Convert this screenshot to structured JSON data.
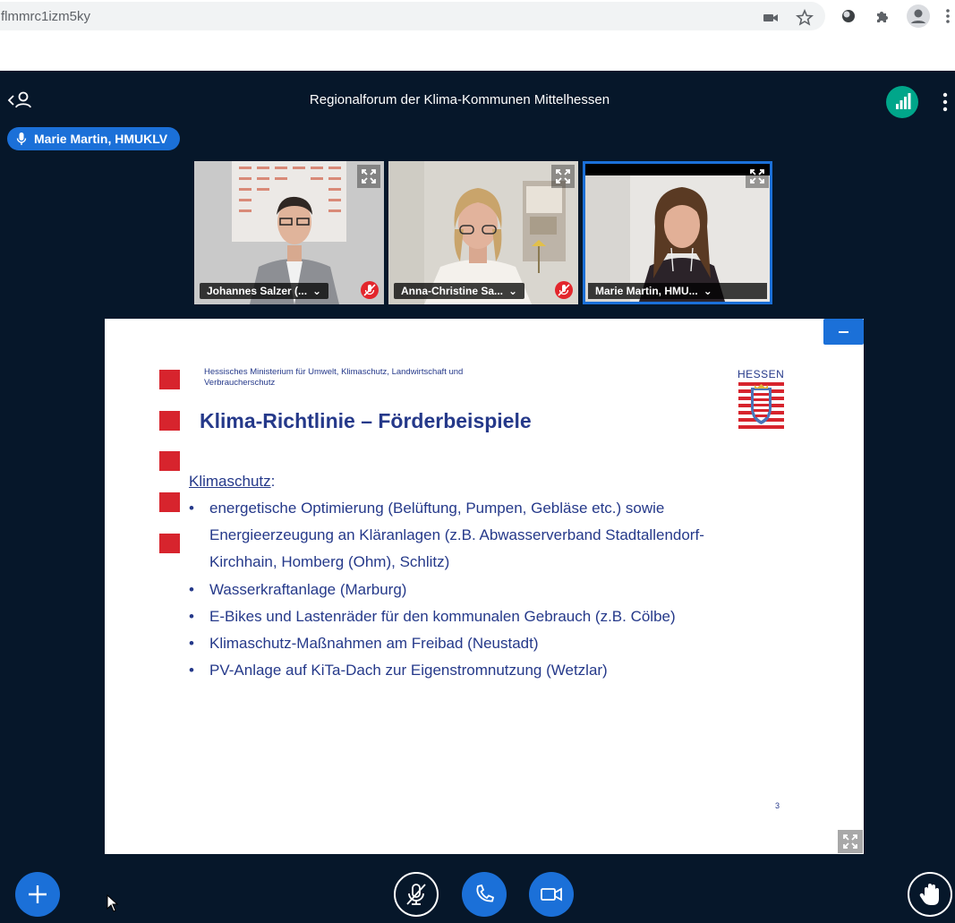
{
  "browser": {
    "url": "flmmrc1izm5ky",
    "icons": [
      "camera-icon",
      "star-icon",
      "extension-circle-icon",
      "puzzle-icon",
      "profile-icon",
      "kebab-menu-icon"
    ]
  },
  "meeting": {
    "title": "Regionalforum der Klima-Kommunen Mittelhessen",
    "talker": "Marie Martin, HMUKLV"
  },
  "videos": [
    {
      "name": "Johannes Salzer (...",
      "muted": true
    },
    {
      "name": "Anna-Christine Sa...",
      "muted": true
    },
    {
      "name": "Marie Martin, HMU...",
      "muted": false
    }
  ],
  "slide": {
    "ministry": "Hessisches Ministerium für Umwelt, Klimaschutz, Landwirtschaft und Verbraucherschutz",
    "title": "Klima-Richtlinie – Förderbeispiele",
    "hessen_label": "HESSEN",
    "section_heading": "Klimaschutz",
    "section_colon": ":",
    "bullet_char": "•",
    "bullets": [
      {
        "line1": "energetische Optimierung (Belüftung, Pumpen, Gebläse etc.) sowie",
        "line2": "Energieerzeugung an Kläranlagen (z.B. Abwasserverband Stadtallendorf-",
        "line3": "Kirchhain, Homberg (Ohm), Schlitz)"
      },
      {
        "line1": "Wasserkraftanlage (Marburg)"
      },
      {
        "line1": "E-Bikes und Lastenräder für den kommunalen Gebrauch (z.B. Cölbe)"
      },
      {
        "line1": "Klimaschutz-Maßnahmen am Freibad (Neustadt)"
      },
      {
        "line1": "PV-Anlage auf KiTa-Dach zur Eigenstromnutzung (Wetzlar)"
      }
    ],
    "page_number": "3"
  },
  "colors": {
    "app_bg": "#06172a",
    "primary": "#1b70d8",
    "slide_text": "#25398a",
    "slide_square": "#d7242d",
    "mute_red": "#e3262c",
    "connection_green": "#00a68a"
  }
}
